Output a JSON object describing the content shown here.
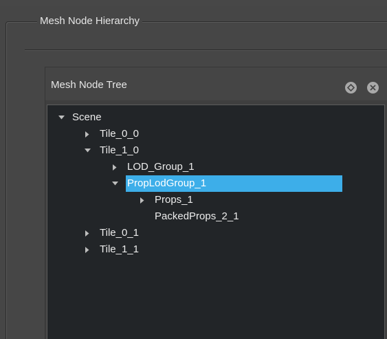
{
  "groupbox": {
    "title": "Mesh Node Hierarchy"
  },
  "panel": {
    "title": "Mesh Node Tree",
    "float_icon": "float-icon",
    "close_icon": "close-icon"
  },
  "tree": {
    "items": [
      {
        "label": "Scene",
        "state": "expanded",
        "depth": 0
      },
      {
        "label": "Tile_0_0",
        "state": "collapsed",
        "depth": 1
      },
      {
        "label": "Tile_1_0",
        "state": "expanded",
        "depth": 1
      },
      {
        "label": "LOD_Group_1",
        "state": "collapsed",
        "depth": 2
      },
      {
        "label": "PropLodGroup_1",
        "state": "expanded",
        "depth": 2,
        "selected": true
      },
      {
        "label": "Props_1",
        "state": "collapsed",
        "depth": 3
      },
      {
        "label": "PackedProps_2_1",
        "state": "leaf",
        "depth": 3
      },
      {
        "label": "Tile_0_1",
        "state": "collapsed",
        "depth": 1
      },
      {
        "label": "Tile_1_1",
        "state": "collapsed",
        "depth": 1
      }
    ]
  },
  "colors": {
    "selection": "#3daee9",
    "tree_background": "#222528",
    "window_background": "#464646"
  }
}
